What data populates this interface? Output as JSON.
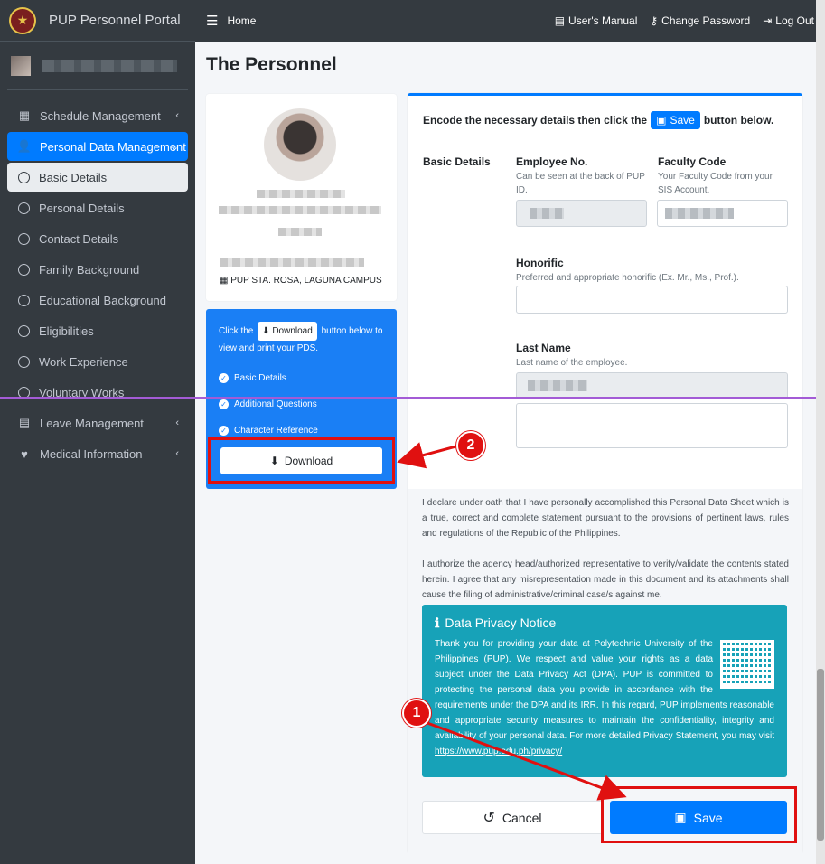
{
  "brand": {
    "title": "PUP Personnel Portal"
  },
  "topbar": {
    "home": "Home",
    "manual": "User's Manual",
    "change_password": "Change Password",
    "logout": "Log Out"
  },
  "sidebar": {
    "items": [
      {
        "label": "Schedule Management"
      },
      {
        "label": "Personal Data Management"
      },
      {
        "label": "Basic Details"
      },
      {
        "label": "Personal Details"
      },
      {
        "label": "Contact Details"
      },
      {
        "label": "Family Background"
      },
      {
        "label": "Educational Background"
      },
      {
        "label": "Eligibilities"
      },
      {
        "label": "Work Experience"
      },
      {
        "label": "Voluntary Works"
      },
      {
        "label": "Leave Management"
      },
      {
        "label": "Medical Information"
      }
    ]
  },
  "page": {
    "title": "The Personnel"
  },
  "profile": {
    "campus": "PUP STA. ROSA, LAGUNA CAMPUS"
  },
  "pds": {
    "text_before": "Click the",
    "download_chip": "Download",
    "text_after": "button below to view and print your PDS.",
    "checks": [
      "Basic Details",
      "Additional Questions",
      "Character Reference"
    ],
    "download_button": "Download"
  },
  "form": {
    "heading_before": "Encode the necessary details then click the",
    "heading_chip": "Save",
    "heading_after": "button below.",
    "section": "Basic Details",
    "employee_no": {
      "label": "Employee No.",
      "hint": "Can be seen at the back of PUP ID."
    },
    "faculty_code": {
      "label": "Faculty Code",
      "hint": "Your Faculty Code from your SIS Account."
    },
    "honorific": {
      "label": "Honorific",
      "hint": "Preferred and appropriate honorific (Ex. Mr., Ms., Prof.)."
    },
    "last_name": {
      "label": "Last Name",
      "hint": "Last name of the employee."
    },
    "declaration_1": "I declare under oath that I have personally accomplished this Personal Data Sheet which is a true, correct and complete statement pursuant to the provisions of pertinent laws, rules and regulations of the Republic of the Philippines.",
    "declaration_2": "I authorize the agency head/authorized representative to verify/validate the contents stated herein. I agree that any misrepresentation made in this document and its attachments shall cause the filing of administrative/criminal case/s against me.",
    "privacy_title": "Data Privacy Notice",
    "privacy_text": "Thank you for providing your data at Polytechnic University of the Philippines (PUP). We respect and value your rights as a data subject under the Data Privacy Act (DPA). PUP is committed to protecting the personal data you provide in accordance with the requirements under the DPA and its IRR. In this regard, PUP implements reasonable and appropriate security measures to maintain the confidentiality, integrity and availability of your personal data. For more detailed Privacy Statement, you may visit",
    "privacy_link": "https://www.pup.edu.ph/privacy/",
    "cancel": "Cancel",
    "save": "Save"
  },
  "annotations": {
    "step1": "1",
    "step2": "2"
  },
  "colors": {
    "sidebar": "#343a40",
    "primary": "#007bff",
    "info": "#17a2b8",
    "highlight": "#e01010"
  }
}
